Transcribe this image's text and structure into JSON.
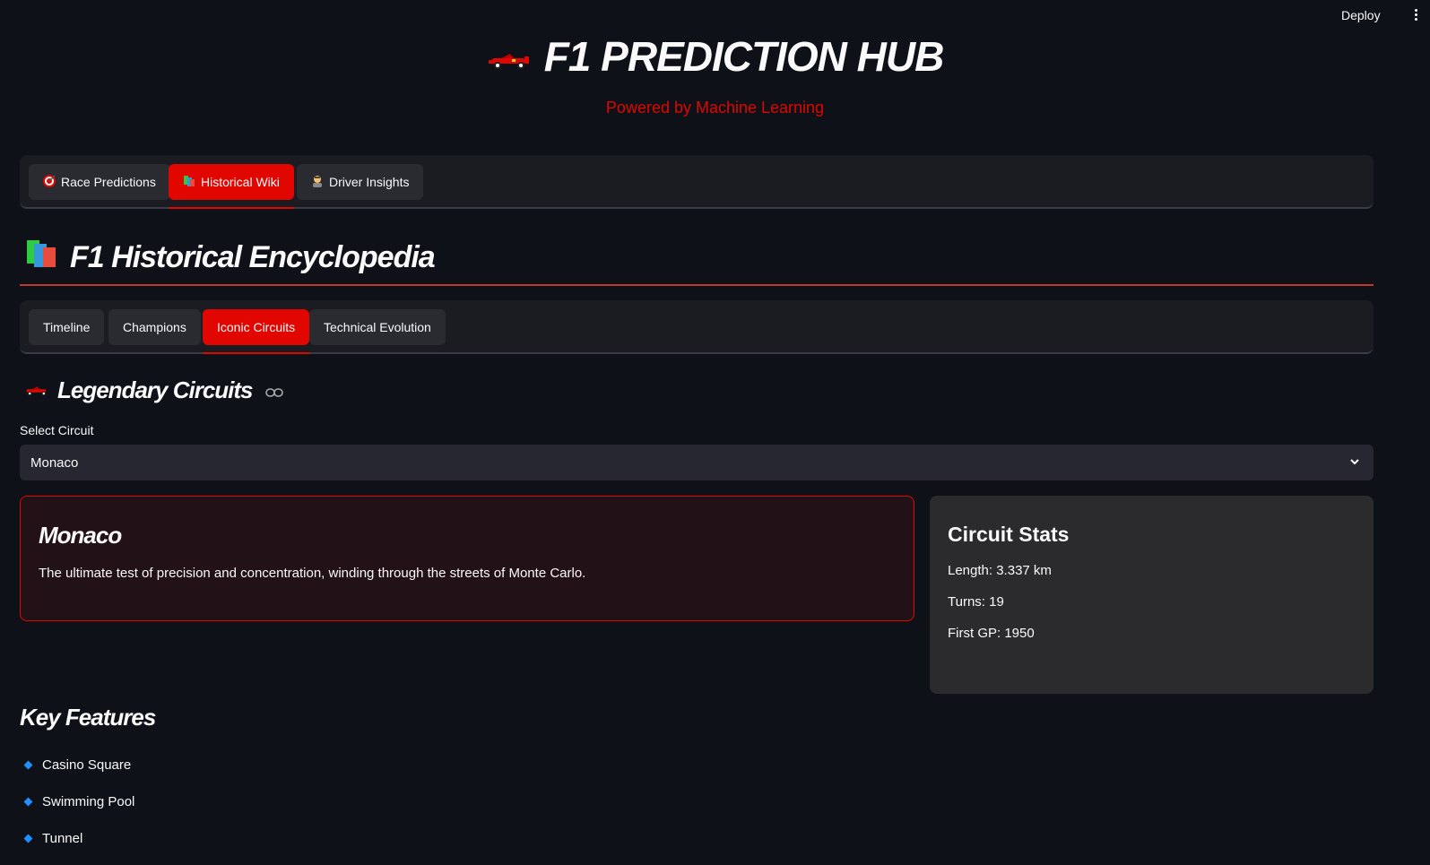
{
  "topbar": {
    "deploy_label": "Deploy"
  },
  "hero": {
    "title": "F1 PREDICTION HUB",
    "subtitle": "Powered by Machine Learning"
  },
  "main_tabs": [
    {
      "label": "Race Predictions",
      "icon": "target-icon",
      "active": false
    },
    {
      "label": "Historical Wiki",
      "icon": "books-icon",
      "active": true
    },
    {
      "label": "Driver Insights",
      "icon": "driver-icon",
      "active": false
    }
  ],
  "encyclopedia": {
    "title": "F1 Historical Encyclopedia"
  },
  "sub_tabs": [
    {
      "label": "Timeline",
      "active": false
    },
    {
      "label": "Champions",
      "active": false
    },
    {
      "label": "Iconic Circuits",
      "active": true
    },
    {
      "label": "Technical Evolution",
      "active": false
    }
  ],
  "circuits": {
    "section_title": "Legendary Circuits",
    "select_label": "Select Circuit",
    "select_value": "Monaco",
    "card": {
      "name": "Monaco",
      "description": "The ultimate test of precision and concentration, winding through the streets of Monte Carlo."
    },
    "stats": {
      "title": "Circuit Stats",
      "length": "Length: 3.337 km",
      "turns": "Turns: 19",
      "first_gp": "First GP: 1950"
    },
    "features_title": "Key Features",
    "features": [
      "Casino Square",
      "Swimming Pool",
      "Tunnel"
    ]
  },
  "colors": {
    "accent": "#e10600",
    "background": "#0e1117",
    "bullet": "#1e90ff"
  }
}
